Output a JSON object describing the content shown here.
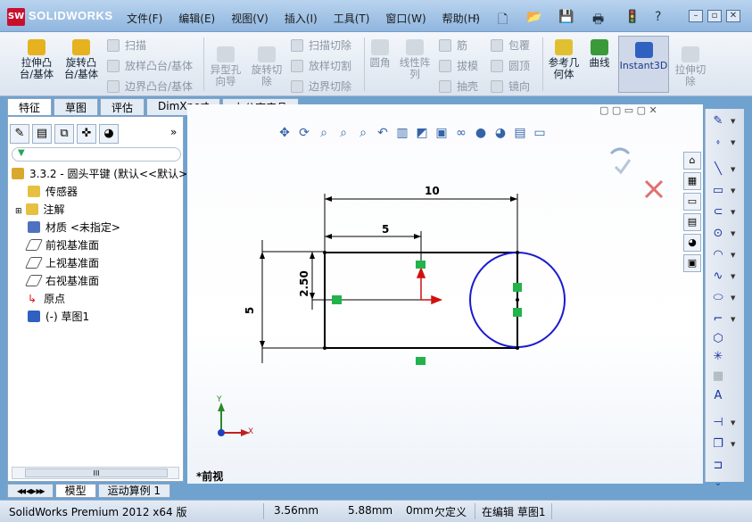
{
  "app": {
    "logo_badge": "SW",
    "logo_text": "SOLIDWORKS",
    "menu": [
      "文件(F)",
      "编辑(E)",
      "视图(V)",
      "插入(I)",
      "工具(T)",
      "窗口(W)",
      "帮助(H)"
    ]
  },
  "ribbon": {
    "extrude_boss": "拉伸凸台/基体",
    "revolve_boss": "旋转凸台/基体",
    "sweep": "扫描",
    "loft_boss": "放样凸台/基体",
    "boundary_boss": "边界凸台/基体",
    "hole_wizard": "异型孔向导",
    "revolve_cut": "旋转切除",
    "sweep_cut": "扫描切除",
    "loft_cut": "放样切割",
    "boundary_cut": "边界切除",
    "fillet": "圆角",
    "linear_pattern": "线性阵列",
    "rib": "筋",
    "draft": "拔模",
    "shell": "抽壳",
    "wrap": "包覆",
    "dome": "圆顶",
    "mirror": "镜向",
    "ref_geometry": "参考几何体",
    "curves": "曲线",
    "instant3d": "Instant3D",
    "extrude_cut": "拉伸切除"
  },
  "tabs": [
    "特征",
    "草图",
    "评估",
    "DimXpert",
    "办公室产品"
  ],
  "tree": {
    "root": "3.3.2 - 圆头平键 (默认<<默认>",
    "sensors": "传感器",
    "annotations": "注解",
    "material": "材质 <未指定>",
    "front_plane": "前视基准面",
    "top_plane": "上视基准面",
    "right_plane": "右视基准面",
    "origin": "原点",
    "sketch": "(-) 草图1",
    "scroll_thumb": "III"
  },
  "sketch": {
    "dim_width": "10",
    "dim_half": "5",
    "dim_height": "5",
    "dim_center": "2.50",
    "axis_x": "X",
    "axis_y": "Y",
    "view_name": "*前视"
  },
  "bottom_tabs": [
    "模型",
    "运动算例 1"
  ],
  "status": {
    "product": "SolidWorks Premium 2012 x64 版",
    "x": "3.56mm",
    "y": "5.88mm",
    "z": "0mm",
    "state": "欠定义",
    "mode": "在编辑 草图1"
  },
  "colors": {
    "sketch_line": "#000000",
    "circle": "#1a1ad0",
    "relation": "#22b34a",
    "origin": "#d01010"
  }
}
